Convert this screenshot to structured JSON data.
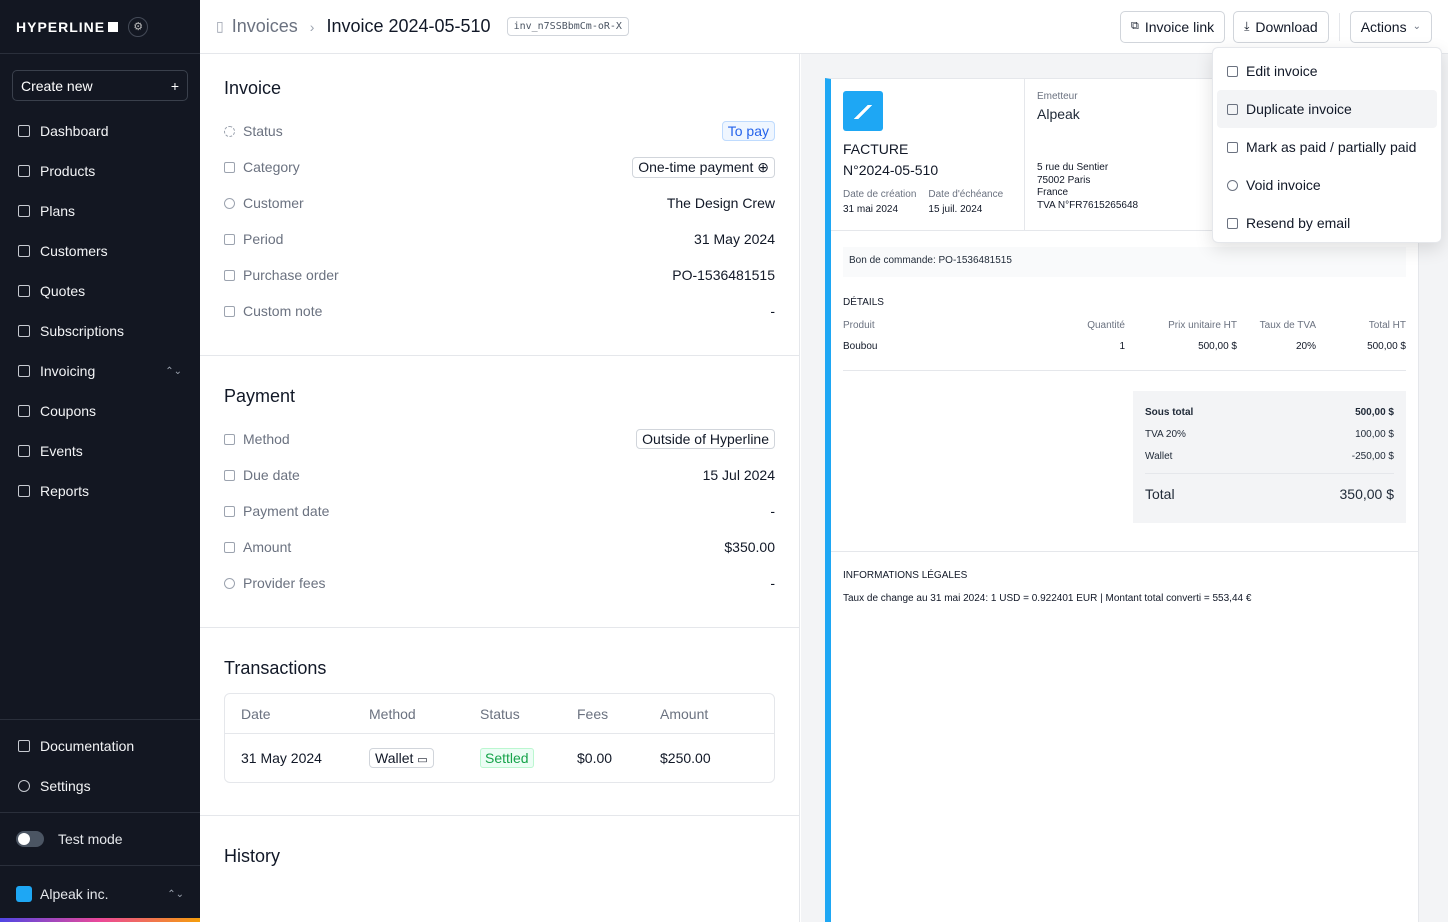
{
  "app": {
    "logo": "HYPERLINE"
  },
  "sidebar": {
    "create_label": "Create new",
    "items": [
      {
        "label": "Dashboard",
        "icon": "chart-line-icon"
      },
      {
        "label": "Products",
        "icon": "cube-icon"
      },
      {
        "label": "Plans",
        "icon": "book-icon"
      },
      {
        "label": "Customers",
        "icon": "users-icon"
      },
      {
        "label": "Quotes",
        "icon": "document-icon"
      },
      {
        "label": "Subscriptions",
        "icon": "refresh-icon"
      },
      {
        "label": "Invoicing",
        "icon": "receipt-icon"
      },
      {
        "label": "Coupons",
        "icon": "tag-icon"
      },
      {
        "label": "Events",
        "icon": "database-icon"
      },
      {
        "label": "Reports",
        "icon": "bar-chart-icon"
      }
    ],
    "documentation": "Documentation",
    "settings": "Settings",
    "test_mode": "Test mode",
    "org": "Alpeak inc."
  },
  "header": {
    "breadcrumb_root": "Invoices",
    "title": "Invoice 2024-05-510",
    "invoice_id": "inv_n7SSBbmCm-oR-X",
    "invoice_link": "Invoice link",
    "download": "Download",
    "actions": "Actions"
  },
  "invoice": {
    "heading": "Invoice",
    "rows": [
      {
        "label": "Status",
        "value": "To pay"
      },
      {
        "label": "Category",
        "value": "One-time payment"
      },
      {
        "label": "Customer",
        "value": "The Design Crew"
      },
      {
        "label": "Period",
        "value": "31 May 2024"
      },
      {
        "label": "Purchase order",
        "value": "PO-1536481515"
      },
      {
        "label": "Custom note",
        "value": "-"
      }
    ]
  },
  "payment": {
    "heading": "Payment",
    "rows": [
      {
        "label": "Method",
        "value": "Outside of Hyperline"
      },
      {
        "label": "Due date",
        "value": "15 Jul 2024"
      },
      {
        "label": "Payment date",
        "value": "-"
      },
      {
        "label": "Amount",
        "value": "$350.00"
      },
      {
        "label": "Provider fees",
        "value": "-"
      }
    ]
  },
  "transactions": {
    "heading": "Transactions",
    "columns": [
      "Date",
      "Method",
      "Status",
      "Fees",
      "Amount"
    ],
    "rows": [
      {
        "date": "31 May 2024",
        "method": "Wallet",
        "status": "Settled",
        "fees": "$0.00",
        "amount": "$250.00"
      }
    ]
  },
  "history": {
    "heading": "History"
  },
  "doc": {
    "facture": "FACTURE",
    "number": "N°2024-05-510",
    "date_creation_label": "Date de création",
    "date_creation": "31 mai 2024",
    "date_echeance_label": "Date d'échéance",
    "date_echeance": "15 juil. 2024",
    "emetteur_label": "Emetteur",
    "emetteur": "Alpeak",
    "address": [
      "5 rue du Sentier",
      "75002 Paris",
      "France",
      "TVA N°FR7615265648"
    ],
    "bon": "Bon de commande: PO-1536481515",
    "details_title": "DÉTAILS",
    "details_cols": [
      "Produit",
      "Quantité",
      "Prix unitaire HT",
      "Taux de TVA",
      "Total HT"
    ],
    "details_row": [
      "Boubou",
      "1",
      "500,00 $",
      "20%",
      "500,00 $"
    ],
    "totals": [
      {
        "label": "Sous total",
        "value": "500,00 $"
      },
      {
        "label": "TVA 20%",
        "value": "100,00 $"
      },
      {
        "label": "Wallet",
        "value": "-250,00 $"
      }
    ],
    "total_label": "Total",
    "total_value": "350,00 $",
    "legal_title": "INFORMATIONS LÉGALES",
    "legal_text": "Taux de change au 31 mai 2024: 1 USD = 0.922401 EUR | Montant total converti = 553,44 €"
  },
  "actions_menu": [
    "Edit invoice",
    "Duplicate invoice",
    "Mark as paid / partially paid",
    "Void invoice",
    "Resend by email"
  ]
}
